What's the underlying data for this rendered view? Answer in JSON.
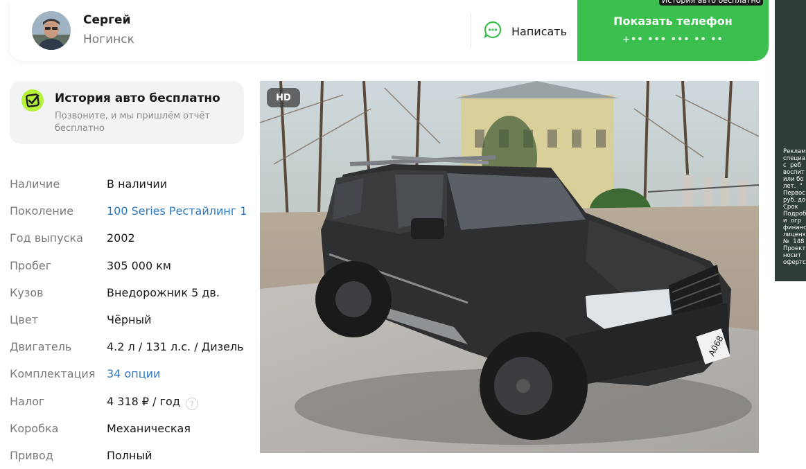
{
  "seller": {
    "name": "Сергей",
    "city": "Ногинск",
    "write_label": "Написать",
    "phone_label": "Показать телефон",
    "phone_masked": "+•• ••• ••• •• ••",
    "ad_tag": "История авто бесплатно"
  },
  "side_ad": {
    "text": "Реклам\nспециа\nс  реб\nвоспит\nили бо\nлет.  \"\nПервос\nруб. до\nСрок \nПодроб\nи  огр\nфинанс\nлиценз\n№  148\nПроект\nносит\nофертс"
  },
  "history": {
    "title": "История авто бесплатно",
    "subtitle": "Позвоните, и мы пришлём отчёт бесплатно"
  },
  "specs": [
    {
      "key": "Наличие",
      "value": "В наличии",
      "link": false
    },
    {
      "key": "Поколение",
      "value": "100 Series Рестайлинг 1",
      "link": true
    },
    {
      "key": "Год выпуска",
      "value": "2002",
      "link": false
    },
    {
      "key": "Пробег",
      "value": "305 000 км",
      "link": false
    },
    {
      "key": "Кузов",
      "value": "Внедорожник 5 дв.",
      "link": false
    },
    {
      "key": "Цвет",
      "value": "Чёрный",
      "link": false
    },
    {
      "key": "Двигатель",
      "value": "4.2 л / 131 л.с. / Дизель",
      "link": false
    },
    {
      "key": "Комплектация",
      "value": "34 опции",
      "link": true
    },
    {
      "key": "Налог",
      "value": "4 318 ₽ / год",
      "link": false
    },
    {
      "key": "Коробка",
      "value": "Механическая",
      "link": false
    },
    {
      "key": "Привод",
      "value": "Полный",
      "link": false
    }
  ],
  "photo": {
    "badge": "HD",
    "plate": "А068"
  },
  "colors": {
    "accent_green": "#3bbf4f",
    "link_blue": "#2b79c2",
    "badge_lime": "#b6f23c"
  }
}
